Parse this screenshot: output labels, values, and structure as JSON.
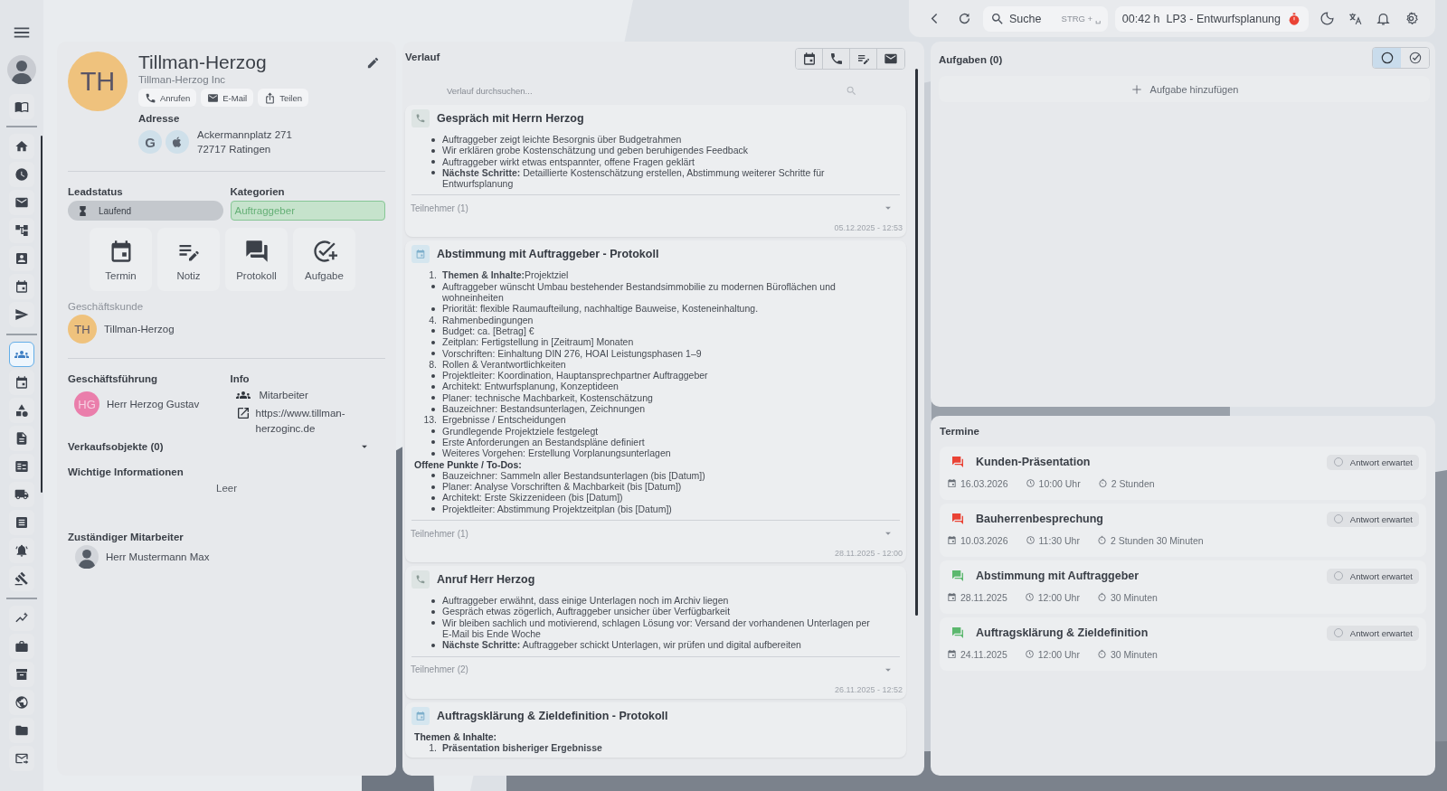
{
  "sidebar": {
    "items": [
      {
        "selected": false
      },
      {
        "selected": false
      },
      {
        "selected": false
      },
      {
        "selected": false
      },
      {
        "selected": false
      },
      {
        "selected": false
      },
      {
        "selected": false
      },
      {
        "selected": false
      },
      {
        "selected": true
      },
      {
        "selected": false
      },
      {
        "selected": false
      },
      {
        "selected": false
      },
      {
        "selected": false
      },
      {
        "selected": false
      },
      {
        "selected": false
      },
      {
        "selected": false
      },
      {
        "selected": false
      },
      {
        "selected": false
      },
      {
        "selected": false
      },
      {
        "selected": false
      },
      {
        "selected": false
      },
      {
        "selected": false
      },
      {
        "selected": false
      }
    ]
  },
  "topbar": {
    "search": {
      "placeholder": "Suche",
      "shortcut": "STRG + ␣"
    },
    "timer": {
      "time": "00:42 h",
      "project": "LP3 - Entwurfsplanung"
    }
  },
  "contact": {
    "initials": "TH",
    "name": "Tillman-Herzog",
    "company": "Tillman-Herzog Inc",
    "actions": [
      "Anrufen",
      "E-Mail",
      "Teilen"
    ],
    "address_label": "Adresse",
    "map_label": "G",
    "address_lines": [
      "Ackermannplatz 271",
      "72717 Ratingen"
    ]
  },
  "lead": {
    "status_label": "Leadstatus",
    "status": "Laufend",
    "categories_label": "Kategorien",
    "category": "Auftraggeber"
  },
  "quick_actions": [
    "Termin",
    "Notiz",
    "Protokoll",
    "Aufgabe"
  ],
  "business_customer": {
    "label": "Geschäftskunde",
    "initials": "TH",
    "name": "Tillman-Herzog"
  },
  "management": {
    "label": "Geschäftsführung",
    "initials": "HG",
    "name": "Herr Herzog Gustav"
  },
  "info": {
    "label": "Info",
    "type": "Mitarbeiter",
    "website": "https://www.tillman-herzoginc.de"
  },
  "sales_objects": {
    "label": "Verkaufsobjekte (0)",
    "expanded": false
  },
  "important": {
    "label": "Wichtige Informationen",
    "value": "Leer"
  },
  "responsible": {
    "label": "Zuständiger Mitarbeiter",
    "name": "Herr Mustermann Max"
  },
  "history": {
    "title": "Verlauf",
    "search": {
      "placeholder": "Verlauf durchsuchen..."
    },
    "entries": [
      {
        "kind": "call",
        "title": "Gespräch mit Herrn Herzog",
        "blocks": [
          {
            "kind": "bullet",
            "text": "Auftraggeber zeigt leichte Besorgnis über Budgetrahmen"
          },
          {
            "kind": "bullet",
            "text": "Wir erklären grobe Kostenschätzung und geben beruhigendes Feedback"
          },
          {
            "kind": "bullet",
            "text": "Auftraggeber wirkt etwas entspannter, offene Fragen geklärt"
          },
          {
            "kind": "bullet",
            "text": "**Nächste Schritte:** Detaillierte Kostenschätzung erstellen, Abstimmung weiterer Schritte für Entwurfsplanung"
          }
        ],
        "participants": "Teilnehmer (1)",
        "expanded": false,
        "timestamp": "05.12.2025 - 12:53"
      },
      {
        "kind": "protocol",
        "title": "Abstimmung mit Auftraggeber - Protokoll",
        "blocks": [
          {
            "kind": "number",
            "number": "1.",
            "text": "**Themen & Inhalte:**Projektziel"
          },
          {
            "kind": "bullet",
            "text": "Auftraggeber wünscht Umbau bestehender Bestandsimmobilie zu modernen Büroflächen und wohneinheiten"
          },
          {
            "kind": "bullet",
            "text": "Priorität: flexible Raumaufteilung, nachhaltige Bauweise, Kosteneinhaltung."
          },
          {
            "kind": "number",
            "number": "4.",
            "text": "Rahmenbedingungen"
          },
          {
            "kind": "bullet",
            "text": "Budget: ca. [Betrag] €"
          },
          {
            "kind": "bullet",
            "text": "Zeitplan: Fertigstellung in [Zeitraum] Monaten"
          },
          {
            "kind": "bullet",
            "text": "Vorschriften: Einhaltung DIN 276, HOAI Leistungsphasen 1–9"
          },
          {
            "kind": "number",
            "number": "8.",
            "text": "Rollen & Verantwortlichkeiten"
          },
          {
            "kind": "bullet",
            "text": "Projektleiter: Koordination, Hauptansprechpartner Auftraggeber"
          },
          {
            "kind": "bullet",
            "text": "Architekt: Entwurfsplanung, Konzeptideen"
          },
          {
            "kind": "bullet",
            "text": "Planer: technische Machbarkeit, Kostenschätzung"
          },
          {
            "kind": "bullet",
            "text": "Bauzeichner: Bestandsunterlagen, Zeichnungen"
          },
          {
            "kind": "number",
            "number": "13.",
            "text": "Ergebnisse / Entscheidungen"
          },
          {
            "kind": "bullet",
            "text": "Grundlegende Projektziele festgelegt"
          },
          {
            "kind": "bullet",
            "text": "Erste Anforderungen an Bestandspläne definiert"
          },
          {
            "kind": "bullet",
            "text": "Weiteres Vorgehen: Erstellung Vorplanungsunterlagen"
          },
          {
            "kind": "heading",
            "text": "Offene Punkte / To-Dos:"
          },
          {
            "kind": "bullet",
            "text": "Bauzeichner: Sammeln aller Bestandsunterlagen (bis [Datum])"
          },
          {
            "kind": "bullet",
            "text": "Planer: Analyse Vorschriften & Machbarkeit (bis [Datum])"
          },
          {
            "kind": "bullet",
            "text": "Architekt: Erste Skizzenideen (bis [Datum])"
          },
          {
            "kind": "bullet",
            "text": "Projektleiter: Abstimmung Projektzeitplan (bis [Datum])"
          }
        ],
        "participants": "Teilnehmer (1)",
        "expanded": false,
        "timestamp": "28.11.2025 - 12:00"
      },
      {
        "kind": "call",
        "title": "Anruf Herr Herzog",
        "blocks": [
          {
            "kind": "bullet",
            "text": "Auftraggeber erwähnt, dass einige Unterlagen noch im Archiv liegen"
          },
          {
            "kind": "bullet",
            "text": "Gespräch etwas zögerlich, Auftraggeber unsicher über Verfügbarkeit"
          },
          {
            "kind": "bullet",
            "text": "Wir bleiben sachlich und motivierend, schlagen Lösung vor: Versand der vorhandenen Unterlagen per E-Mail bis Ende Woche"
          },
          {
            "kind": "bullet",
            "text": "**Nächste Schritte:** Auftraggeber schickt Unterlagen, wir prüfen und digital aufbereiten"
          }
        ],
        "participants": "Teilnehmer (2)",
        "expanded": false,
        "timestamp": "26.11.2025 - 12:52"
      },
      {
        "kind": "protocol",
        "title": "Auftragsklärung & Zieldefinition - Protokoll",
        "blocks": [
          {
            "kind": "heading",
            "text": "Themen & Inhalte:"
          },
          {
            "kind": "number-strong",
            "number": "1.",
            "text": "Präsentation bisheriger Ergebnisse"
          }
        ]
      }
    ]
  },
  "tasks": {
    "title": "Aufgaben (0)",
    "filters": [
      {
        "selected": true
      },
      {
        "selected": false
      }
    ],
    "add": "Aufgabe hinzufügen"
  },
  "appointments": {
    "title": "Termine",
    "items": [
      {
        "title": "Kunden-Präsentation",
        "color": "#ea4335",
        "status": "Antwort erwartet",
        "date": "16.03.2026",
        "time": "10:00 Uhr",
        "duration": "2 Stunden"
      },
      {
        "title": "Bauherrenbesprechung",
        "color": "#ea4335",
        "status": "Antwort erwartet",
        "date": "10.03.2026",
        "time": "11:30 Uhr",
        "duration": "2 Stunden 30 Minuten"
      },
      {
        "title": "Abstimmung mit Auftraggeber",
        "color": "#5cb86e",
        "status": "Antwort erwartet",
        "date": "28.11.2025",
        "time": "12:00 Uhr",
        "duration": "30 Minuten"
      },
      {
        "title": "Auftragsklärung & Zieldefinition",
        "color": "#5cb86e",
        "status": "Antwort erwartet",
        "date": "24.11.2025",
        "time": "12:00 Uhr",
        "duration": "30 Minuten"
      }
    ]
  }
}
